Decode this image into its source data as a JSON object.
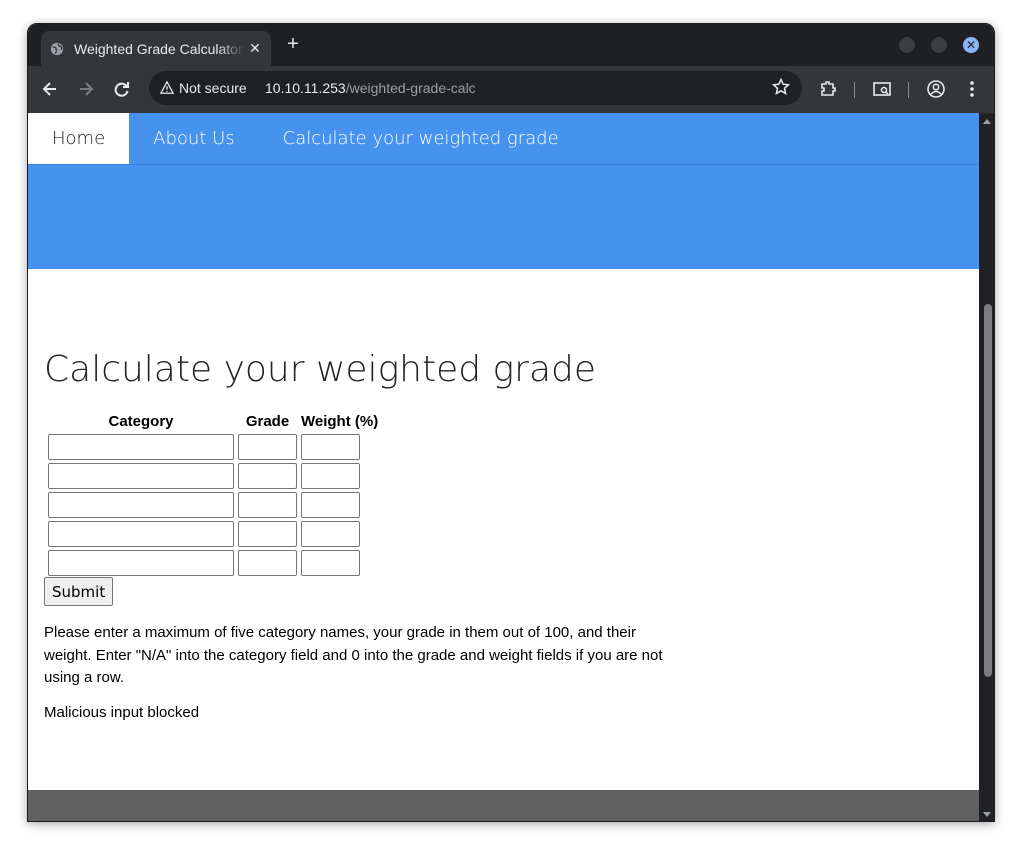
{
  "browser": {
    "tab_title": "Weighted Grade Calculator",
    "new_tab": "+",
    "close_tab": "✕",
    "security_label": "Not secure",
    "url_host": "10.10.11.253",
    "url_path": "/weighted-grade-calc",
    "icons": [
      "globe-icon",
      "back-icon",
      "forward-icon",
      "reload-icon",
      "warning-icon",
      "star-icon",
      "extensions-icon",
      "tab-search-icon",
      "profile-icon",
      "menu-icon"
    ]
  },
  "nav": {
    "items": [
      {
        "label": "Home",
        "active": true
      },
      {
        "label": "About Us",
        "active": false
      },
      {
        "label": "Calculate your weighted grade",
        "active": false
      }
    ]
  },
  "page": {
    "title": "Calculate your weighted grade",
    "table": {
      "headers": [
        "Category",
        "Grade",
        "Weight (%)"
      ],
      "rows": [
        {
          "category": "",
          "grade": "",
          "weight": ""
        },
        {
          "category": "",
          "grade": "",
          "weight": ""
        },
        {
          "category": "",
          "grade": "",
          "weight": ""
        },
        {
          "category": "",
          "grade": "",
          "weight": ""
        },
        {
          "category": "",
          "grade": "",
          "weight": ""
        }
      ]
    },
    "submit_label": "Submit",
    "instructions": "Please enter a maximum of five category names, your grade in them out of 100, and their weight. Enter \"N/A\" into the category field and 0 into the grade and weight fields if you are not using a row.",
    "message": "Malicious input blocked"
  },
  "colors": {
    "nav_bg": "#4693ef",
    "footer_bg": "#616161",
    "browser_frame": "#35363a"
  }
}
